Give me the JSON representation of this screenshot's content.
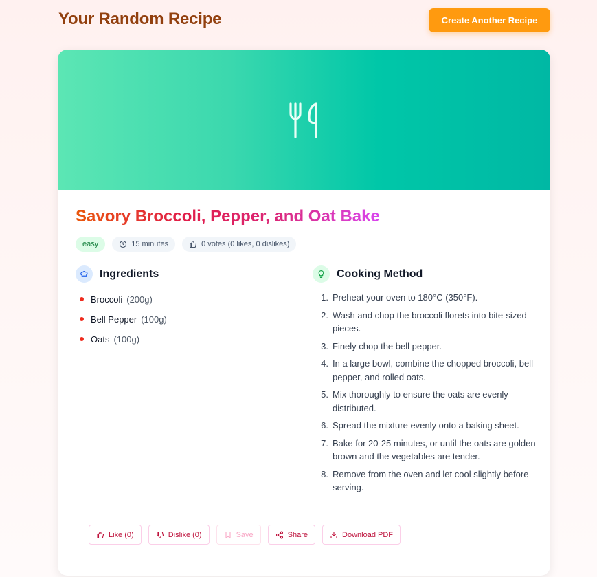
{
  "header": {
    "title": "Your Random Recipe",
    "create_button": "Create Another Recipe"
  },
  "recipe": {
    "title": "Savory Broccoli, Pepper, and Oat Bake",
    "difficulty": "easy",
    "time": "15 minutes",
    "votes": "0 votes (0 likes, 0 dislikes)",
    "hero_icon": "utensils-icon"
  },
  "ingredients": {
    "heading": "Ingredients",
    "items": [
      {
        "name": "Broccoli",
        "qty": "(200g)"
      },
      {
        "name": "Bell Pepper",
        "qty": "(100g)"
      },
      {
        "name": "Oats",
        "qty": "(100g)"
      }
    ]
  },
  "method": {
    "heading": "Cooking Method",
    "steps": [
      {
        "num": "1.",
        "text": "Preheat your oven to 180°C (350°F)."
      },
      {
        "num": "2.",
        "text": "Wash and chop the broccoli florets into bite-sized pieces."
      },
      {
        "num": "3.",
        "text": "Finely chop the bell pepper."
      },
      {
        "num": "4.",
        "text": "In a large bowl, combine the chopped broccoli, bell pepper, and rolled oats."
      },
      {
        "num": "5.",
        "text": "Mix thoroughly to ensure the oats are evenly distributed."
      },
      {
        "num": "6.",
        "text": "Spread the mixture evenly onto a baking sheet."
      },
      {
        "num": "7.",
        "text": "Bake for 20-25 minutes, or until the oats are golden brown and the vegetables are tender."
      },
      {
        "num": "8.",
        "text": "Remove from the oven and let cool slightly before serving."
      }
    ]
  },
  "actions": {
    "like": "Like (0)",
    "dislike": "Dislike (0)",
    "save": "Save",
    "share": "Share",
    "download": "Download PDF"
  },
  "colors": {
    "brand_title": "#92400e",
    "accent_orange": "#ff9a0f",
    "hero_start": "#5ce6b4",
    "hero_end": "#00b8a4",
    "action_text": "#be123c"
  }
}
